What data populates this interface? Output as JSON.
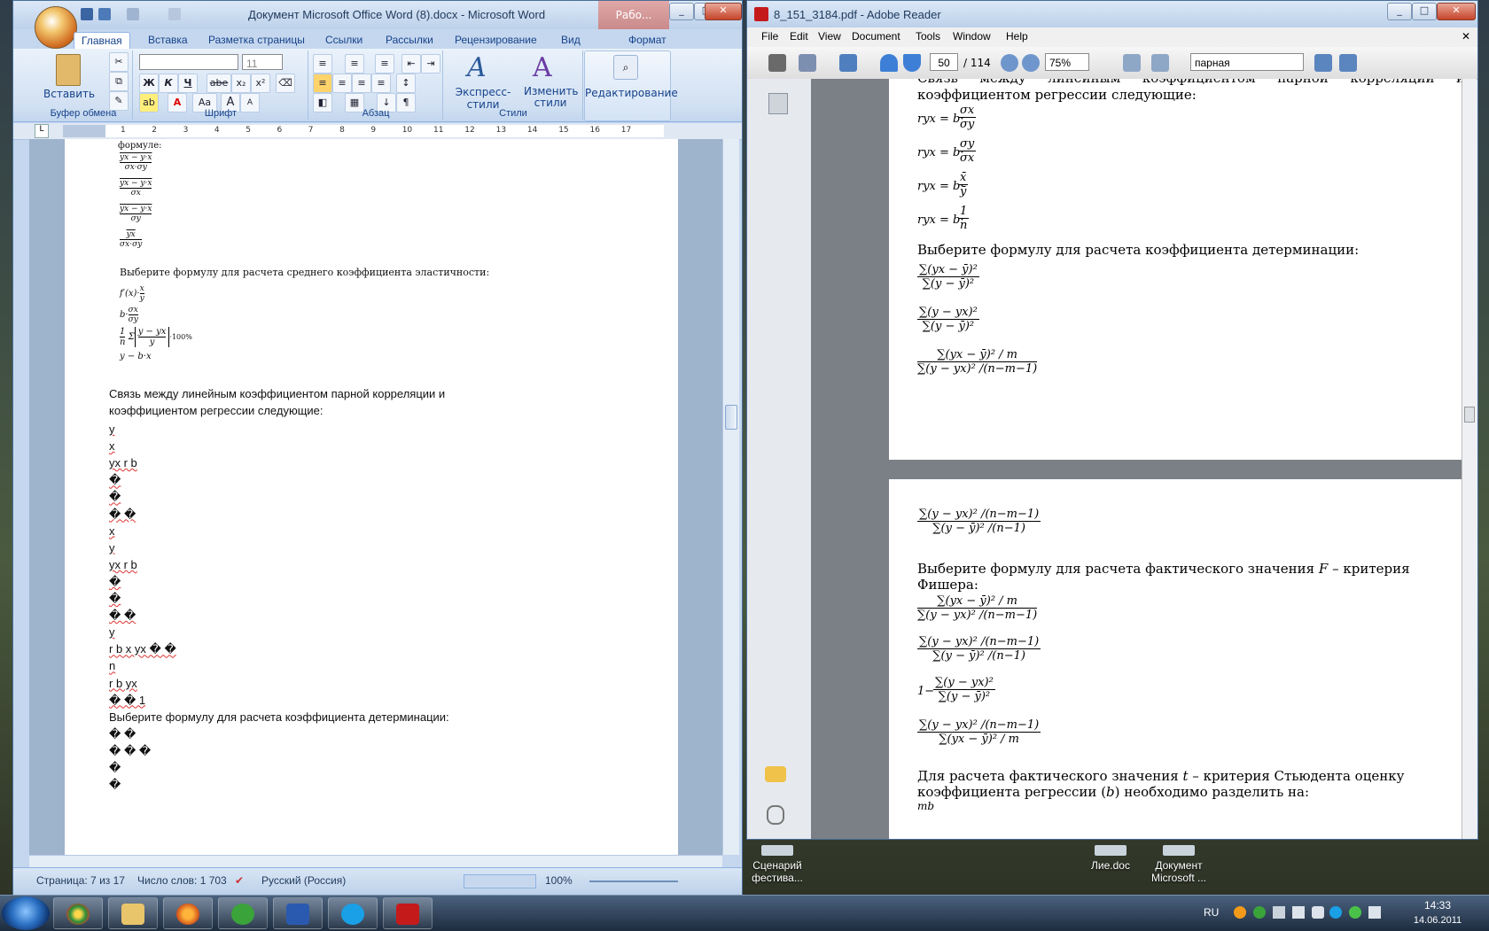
{
  "desktop": {
    "icons": [
      {
        "label": "Сценарий фестива..."
      },
      {
        "label": "Лие.doc"
      },
      {
        "label": "Документ Microsoft ..."
      }
    ]
  },
  "word": {
    "title": "Документ Microsoft Office Word (8).docx - Microsoft Word",
    "context_tab": "Рабо...",
    "tabs": [
      "Главная",
      "Вставка",
      "Разметка страницы",
      "Ссылки",
      "Рассылки",
      "Рецензирование",
      "Вид",
      "Формат"
    ],
    "ribbon": {
      "paste_label": "Вставить",
      "clipboard_group": "Буфер обмена",
      "font_size": "11",
      "font_group": "Шрифт",
      "paragraph_group": "Абзац",
      "quick_styles": "Экспресс-стили",
      "change_styles": "Изменить стили",
      "styles_group": "Стили",
      "editing": "Редактирование",
      "bold": "Ж",
      "italic": "К",
      "underline": "Ч",
      "strike": "abe",
      "sub": "x₂",
      "sup": "x²",
      "case": "Aa",
      "grow": "A",
      "shrink": "A",
      "pilcrow": "¶"
    },
    "ruler": [
      "1",
      "2",
      "3",
      "4",
      "5",
      "6",
      "7",
      "8",
      "9",
      "10",
      "11",
      "12",
      "13",
      "14",
      "15",
      "16",
      "17"
    ],
    "doc": {
      "top_label": "формуле:",
      "elasticity_heading": "Выберите формулу для расчета среднего коэффициента эластичности:",
      "el_f1": "f′(x)·",
      "el_f1b": "x",
      "el_f1c": "y",
      "el_f2": "b·",
      "el_f2b": "σx",
      "el_f2c": "σy",
      "el_f3a": "1",
      "el_f3b": "n",
      "el_f3c": "Σ",
      "el_f3d": "y − yx",
      "el_f3e": "y",
      "el_f3f": "·100%",
      "el_f4": "y − b·x",
      "para1_line1": "Связь между линейным коэффициентом парной корреляции и",
      "para1_line2": "коэффициентом регрессии следующие:",
      "lines": [
        "y",
        "x",
        "yx r b",
        "�",
        "�",
        "� �",
        "x",
        "y",
        "yx r b",
        "�",
        "�",
        "� �",
        "y",
        "r b x yx � �",
        "n",
        "r b yx",
        "� � 1"
      ],
      "para2": "Выберите формулу для расчета коэффициента детерминации:",
      "tail": [
        "� �",
        "� � �",
        "�",
        "�"
      ],
      "formulas_top": [
        {
          "num": "yx − y·x",
          "den": "σx·σy"
        },
        {
          "num": "yx − y·x",
          "den": "σx"
        },
        {
          "num": "yx − y·x",
          "den": "σy"
        },
        {
          "num": "yx",
          "den": "σx·σy"
        }
      ]
    },
    "status": {
      "page": "Страница: 7 из 17",
      "words": "Число слов: 1 703",
      "lang": "Русский (Россия)",
      "zoom": "100%"
    }
  },
  "reader": {
    "title": "8_151_3184.pdf - Adobe Reader",
    "menu": [
      "File",
      "Edit",
      "View",
      "Document",
      "Tools",
      "Window",
      "Help"
    ],
    "page_num": "50",
    "page_total": "/ 114",
    "zoom": "75%",
    "search_value": "парная",
    "page1": {
      "text1": "Связь между линейным коэффициентом парной корреляции и коэффициентом регрессии следующие:",
      "f1": {
        "lhs": "ryx = b·",
        "num": "σx",
        "den": "σy"
      },
      "f2": {
        "lhs": "ryx = b·",
        "num": "σy",
        "den": "σx"
      },
      "f3": {
        "lhs": "ryx = b·",
        "num": "x̄",
        "den": "ȳ"
      },
      "f4": {
        "lhs": "ryx = b·",
        "num": "1",
        "den": "n"
      },
      "text2": "Выберите формулу для расчета коэффициента детерминации:",
      "d1": {
        "num": "∑(yx − ȳ)²",
        "den": "∑(y − ȳ)²"
      },
      "d2": {
        "num": "∑(y − yx)²",
        "den": "∑(y − ȳ)²"
      },
      "d3": {
        "num": "∑(yx − ȳ)² / m",
        "den": "∑(y − yx)² /(n−m−1)"
      }
    },
    "page2": {
      "d4": {
        "num": "∑(y − yx)² /(n−m−1)",
        "den": "∑(y − ȳ)² /(n−1)"
      },
      "text3a": "Выберите формулу для расчета фактического значения",
      "text3b": "F",
      "text3c": "– критерия",
      "text3d": "Фишера:",
      "e1": {
        "num": "∑(yx − ȳ)² / m",
        "den": "∑(y − yx)² /(n−m−1)"
      },
      "e2": {
        "num": "∑(y − yx)² /(n−m−1)",
        "den": "∑(y − ȳ)² /(n−1)"
      },
      "e3pre": "1−",
      "e3": {
        "num": "∑(y − yx)²",
        "den": "∑(y − ȳ)²"
      },
      "e4": {
        "num": "∑(y − yx)² /(n−m−1)",
        "den": "∑(yx − ȳ)² / m"
      },
      "text4a": "Для расчета фактического значения",
      "text4b": "t",
      "text4c": "– критерия Стьюдента оценку",
      "text4d": "коэффициента регрессии (",
      "text4e": "b",
      "text4f": ") необходимо разделить на:",
      "text4g": "mb"
    }
  },
  "taskbar": {
    "lang": "RU",
    "time": "14:33",
    "date": "14.06.2011"
  }
}
